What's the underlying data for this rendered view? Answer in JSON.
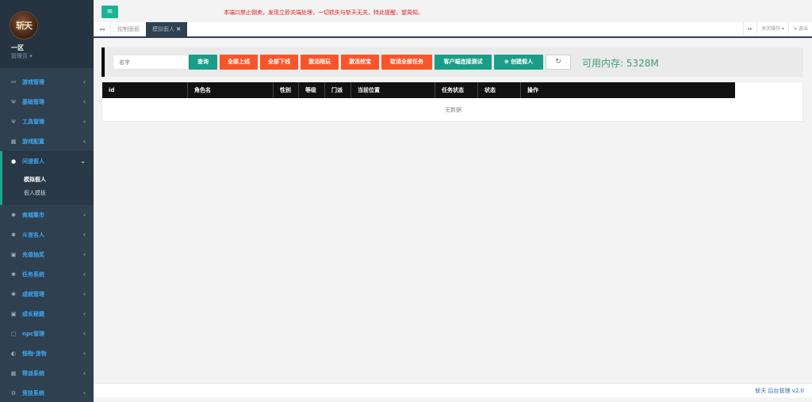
{
  "sidebar": {
    "avatar_text": "斩天",
    "zone": "一区",
    "role": "管理员 ▾",
    "items": [
      {
        "label": "游戏管理",
        "icon": "gamepad-icon"
      },
      {
        "label": "基础管理",
        "icon": "cutlery-icon"
      },
      {
        "label": "工具管理",
        "icon": "cutlery-icon"
      },
      {
        "label": "游戏配置",
        "icon": "table-icon"
      },
      {
        "label": "问道假人",
        "icon": "user-icon"
      },
      {
        "label": "商城集市",
        "icon": "gear-icon"
      },
      {
        "label": "斗宠名人",
        "icon": "gear-icon"
      },
      {
        "label": "充值抽奖",
        "icon": "money-icon"
      },
      {
        "label": "任务系统",
        "icon": "gear-icon"
      },
      {
        "label": "成就管理",
        "icon": "gear-icon"
      },
      {
        "label": "成长秘籍",
        "icon": "money-icon"
      },
      {
        "label": "npc管理",
        "icon": "square-icon"
      },
      {
        "label": "怪物·宠物",
        "icon": "adjust-icon"
      },
      {
        "label": "帮派系统",
        "icon": "table-icon"
      },
      {
        "label": "竞技系统",
        "icon": "cogs-icon"
      }
    ],
    "submenu": [
      "模拟假人",
      "假人模板"
    ]
  },
  "topbar": {
    "notice": "本端口禁止倒卖，发现立即关端处理，一切损失与斩天无关，特此提醒，望周知。"
  },
  "tabs": {
    "items": [
      "控制面板",
      "模拟假人 ✖"
    ],
    "close_ops": "关闭操作 ▾",
    "logout": "⇲ 退出"
  },
  "toolbar": {
    "search_placeholder": "名字",
    "buttons": [
      "查询",
      "全部上线",
      "全部下线",
      "激活陪玩",
      "激活挖宝",
      "取消全部任务",
      "客户端连接测试",
      "⊕ 创建假人"
    ],
    "refresh": "↻",
    "memory": "可用内存: 5328M"
  },
  "table": {
    "columns": [
      "id",
      "角色名",
      "性别",
      "等级",
      "门派",
      "当前位置",
      "任务状态",
      "状态",
      "操作"
    ],
    "empty_text": "无数据"
  },
  "footer": {
    "text": "斩天 后台管理 v2.0"
  },
  "colors": {
    "sidebar": "#2f4050",
    "accent_green": "#1ab394",
    "accent_orange": "#f8562a",
    "notice_red": "#e0201a"
  }
}
